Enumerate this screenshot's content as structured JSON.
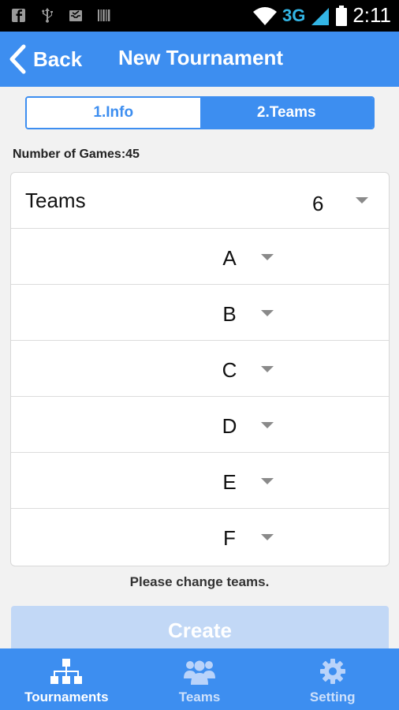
{
  "status_bar": {
    "network": "3G",
    "time": "2:11"
  },
  "header": {
    "back_label": "Back",
    "title": "New Tournament"
  },
  "tabs": [
    {
      "label": "1.Info",
      "active": false
    },
    {
      "label": "2.Teams",
      "active": true
    }
  ],
  "games_text": "Number of Games:45",
  "teams_selector": {
    "label": "Teams",
    "value": "6"
  },
  "teams": [
    "A",
    "B",
    "C",
    "D",
    "E",
    "F"
  ],
  "hint": "Please change teams.",
  "create_label": "Create",
  "bottom_nav": [
    {
      "label": "Tournaments",
      "icon": "bracket-icon",
      "active": true
    },
    {
      "label": "Teams",
      "icon": "people-icon",
      "active": false
    },
    {
      "label": "Setting",
      "icon": "gear-icon",
      "active": false
    }
  ],
  "colors": {
    "accent": "#3d8ef0",
    "disabled_button": "#c2d8f6",
    "status_bar": "#000000",
    "network": "#33b5e5"
  }
}
